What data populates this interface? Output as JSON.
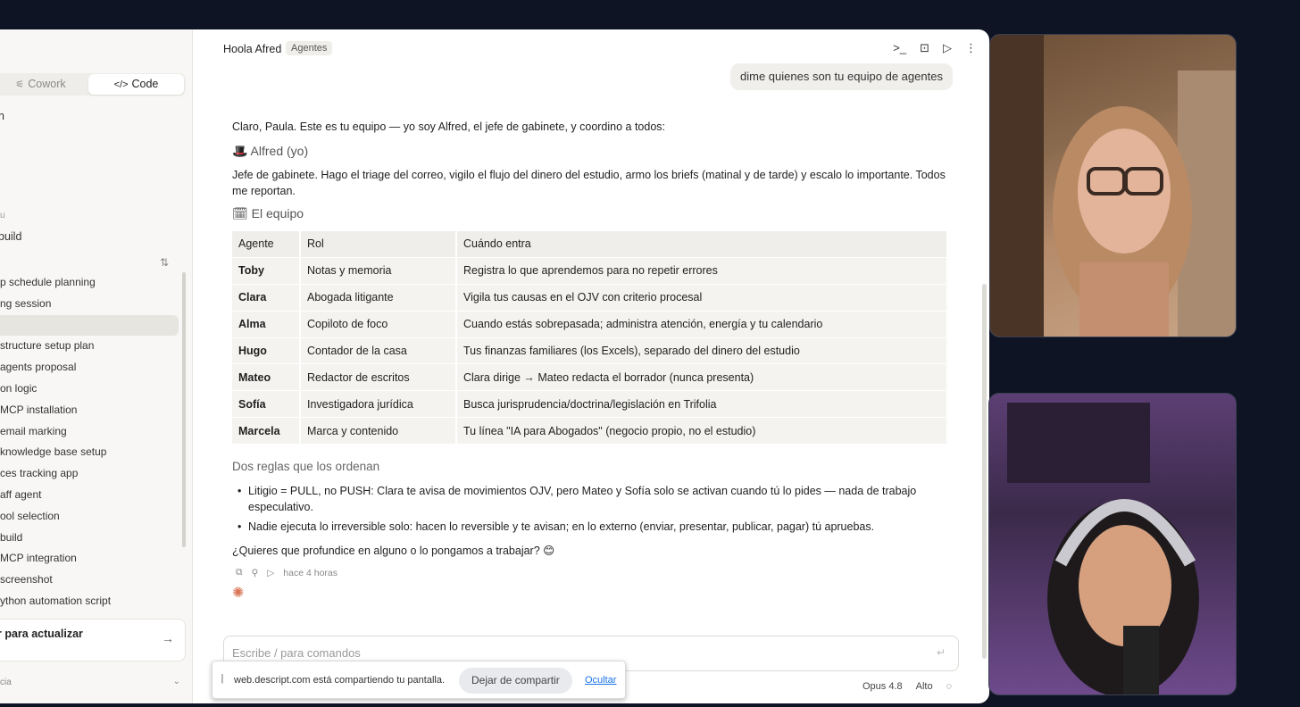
{
  "sidebar": {
    "search_icon": "search-icon",
    "mode_cowork": "Cowork",
    "mode_code": "Code",
    "frag_n": "n",
    "frag_small": "u",
    "frag_build": "build",
    "sessions": [
      "p schedule planning",
      "ng session",
      "",
      "structure setup plan",
      "agents proposal",
      "on logic",
      "MCP installation",
      "email marking",
      "knowledge base setup",
      "ces tracking app",
      "aff agent",
      "ool selection",
      "build",
      "MCP integration",
      "screenshot",
      "ython automation script"
    ],
    "update_label": "r para actualizar",
    "bottom_label": "cia"
  },
  "header": {
    "title": "Hoola Afred",
    "tag": "Agentes"
  },
  "chat": {
    "user_message": "dime quienes son tu equipo de agentes",
    "intro": "Claro, Paula. Este es tu equipo — yo soy Alfred, el jefe de gabinete, y coordino a todos:",
    "alfred_heading": "🎩 Alfred (yo)",
    "jefe_text": "Jefe de gabinete. Hago el triage del correo, vigilo el flujo del dinero del estudio, armo los briefs (matinal y de tarde) y escalo lo importante. Todos me reportan.",
    "equipo_heading": "🗓 El equipo",
    "table": {
      "headers": [
        "Agente",
        "Rol",
        "Cuándo entra"
      ],
      "rows": [
        [
          "Toby",
          "Notas y memoria",
          "Registra lo que aprendemos para no repetir errores"
        ],
        [
          "Clara",
          "Abogada litigante",
          "Vigila tus causas en el OJV con criterio procesal"
        ],
        [
          "Alma",
          "Copiloto de foco",
          "Cuando estás sobrepasada; administra atención, energía y tu calendario"
        ],
        [
          "Hugo",
          "Contador de la casa",
          "Tus finanzas familiares (los Excels), separado del dinero del estudio"
        ],
        [
          "Mateo",
          "Redactor de escritos",
          "Clara dirige → Mateo redacta el borrador (nunca presenta)"
        ],
        [
          "Sofía",
          "Investigadora jurídica",
          "Busca jurisprudencia/doctrina/legislación en Trifolia"
        ],
        [
          "Marcela",
          "Marca y contenido",
          "Tu línea \"IA para Abogados\" (negocio propio, no el estudio)"
        ]
      ]
    },
    "rules_heading": "Dos reglas que los ordenan",
    "rule1": "Litigio = PULL, no PUSH: Clara te avisa de movimientos OJV, pero Mateo y Sofía solo se activan cuando tú lo pides — nada de trabajo especulativo.",
    "rule2": "Nadie ejecuta lo irreversible solo: hacen lo reversible y te avisan; en lo externo (enviar, presentar, publicar, pagar) tú apruebas.",
    "question": "¿Quieres que profundice en alguno o lo pongamos a trabajar? 😊",
    "timestamp": "hace 4 horas"
  },
  "composer": {
    "placeholder": "Escribe / para comandos",
    "model": "Opus 4.8",
    "effort": "Alto"
  },
  "share_bar": {
    "message": "web.descript.com está compartiendo tu pantalla.",
    "stop_label": "Dejar de compartir",
    "hide_label": "Ocultar"
  },
  "colors": {
    "background": "#0f1424",
    "accent": "#d97757",
    "link": "#1a73e8"
  }
}
